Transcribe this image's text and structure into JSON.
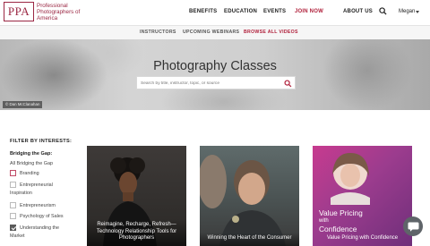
{
  "logo": {
    "mark": "PPA",
    "text": "Professional Photographers of America"
  },
  "nav": {
    "items": [
      "BENEFITS",
      "EDUCATION",
      "EVENTS",
      "JOIN NOW",
      "ABOUT US"
    ],
    "user": "Megan"
  },
  "subnav": {
    "items": [
      "INSTRUCTORS",
      "UPCOMING WEBINARS",
      "BROWSE ALL VIDEOS"
    ],
    "active": "BROWSE ALL VIDEOS"
  },
  "hero": {
    "title": "Photography Classes",
    "search_placeholder": "Search by title, instructor, topic, or source",
    "credit": "© Dan McClanahan"
  },
  "filters": {
    "heading": "FILTER BY INTERESTS:",
    "group": "Bridging the Gap:",
    "items": [
      {
        "label": "All Bridging the Gap",
        "checkbox": false,
        "checked": false
      },
      {
        "label": "Branding",
        "checkbox": true,
        "checked": false
      },
      {
        "label": "Entrepreneurial",
        "checkbox": true,
        "checked": false
      },
      {
        "label": "Inspiration",
        "checkbox": false,
        "checked": false
      },
      {
        "label": "Entrepreneurism",
        "checkbox": true,
        "checked": false
      },
      {
        "label": "Psychology of Sales",
        "checkbox": true,
        "checked": false
      },
      {
        "label": "Understanding the",
        "checkbox": true,
        "checked": true
      },
      {
        "label": "Market",
        "checkbox": false,
        "checked": false
      }
    ]
  },
  "cards": [
    {
      "title": "Reimagine, Recharge, Refresh—Technology Relationship Tools for Photographers"
    },
    {
      "title": "Winning the Heart of the Consumer"
    },
    {
      "title": "Value Pricing with Confidence",
      "overlay_line1": "Value Pricing",
      "overlay_line2": "with",
      "overlay_line3": "Confidence"
    }
  ],
  "colors": {
    "brand": "#9b2743",
    "join": "#b01f3a",
    "active_subnav": "#b01f3a"
  },
  "icons": {
    "search": "search-icon",
    "chat": "chat-icon",
    "caret": "caret-down-icon"
  }
}
